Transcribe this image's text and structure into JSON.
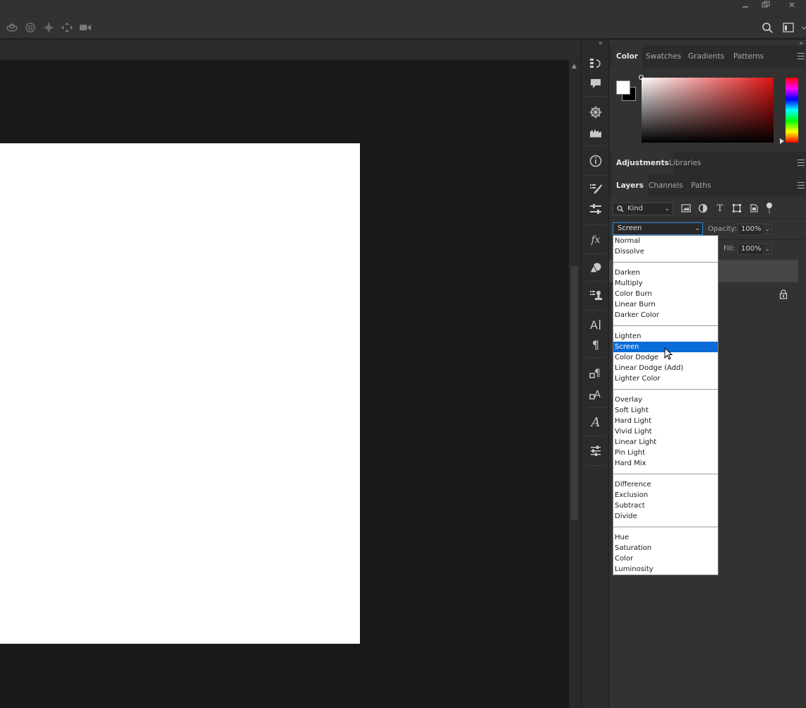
{
  "window": {
    "controls": [
      "minimize-icon",
      "restore-icon",
      "close-icon"
    ],
    "close_glyph": "✕"
  },
  "options_bar": {
    "icons": [
      "orbit-3d-icon",
      "roll-3d-icon",
      "drag-3d-icon",
      "slide-3d-icon",
      "scale-3d-video-icon"
    ],
    "right_icons": [
      "search-icon",
      "workspace-icon"
    ]
  },
  "color_panel": {
    "tabs": [
      "Color",
      "Swatches",
      "Gradients",
      "Patterns"
    ],
    "active_tab": "Color",
    "foreground": "#ffffff",
    "background": "#000000",
    "hue": "#ff0000"
  },
  "adjustments_panel": {
    "tabs": [
      "Adjustments",
      "Libraries"
    ],
    "active_tab": "Adjustments"
  },
  "layers_panel": {
    "tabs": [
      "Layers",
      "Channels",
      "Paths"
    ],
    "active_tab": "Layers",
    "filter": {
      "kind_label": "Kind",
      "icons": [
        "image-filter-icon",
        "adjustment-filter-icon",
        "type-filter-icon",
        "shape-filter-icon",
        "smart-object-filter-icon"
      ]
    },
    "blend_mode": "Screen",
    "opacity_label": "Opacity:",
    "opacity_value": "100%",
    "fill_label": "Fill:",
    "fill_value": "100%"
  },
  "blend_dropdown": {
    "groups": [
      [
        "Normal",
        "Dissolve"
      ],
      [
        "Darken",
        "Multiply",
        "Color Burn",
        "Linear Burn",
        "Darker Color"
      ],
      [
        "Lighten",
        "Screen",
        "Color Dodge",
        "Linear Dodge (Add)",
        "Lighter Color"
      ],
      [
        "Overlay",
        "Soft Light",
        "Hard Light",
        "Vivid Light",
        "Linear Light",
        "Pin Light",
        "Hard Mix"
      ],
      [
        "Difference",
        "Exclusion",
        "Subtract",
        "Divide"
      ],
      [
        "Hue",
        "Saturation",
        "Color",
        "Luminosity"
      ]
    ],
    "selected": "Screen"
  },
  "icon_strip": {
    "icons": [
      "history-icon",
      "comment-icon",
      "navigator-icon",
      "histogram-icon",
      "info-icon",
      "brush-icon",
      "brush-settings-icon",
      "styles-fx-icon",
      "shapes-icon",
      "clone-source-icon",
      "character-icon",
      "paragraph-icon",
      "paragraph-styles-icon",
      "character-styles-icon",
      "glyphs-icon",
      "properties-icon"
    ]
  }
}
